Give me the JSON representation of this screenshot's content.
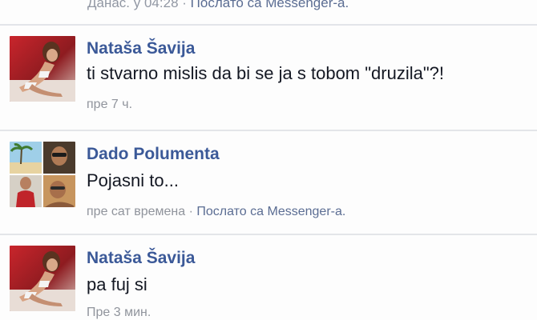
{
  "top_meta": {
    "time": "Данас. у 04:28",
    "separator": " · ",
    "via": "Послато са Messenger-а."
  },
  "messages": [
    {
      "sender": "Nataša Šavija",
      "text": "ti stvarno mislis da bi se ja s tobom \"druzila\"?!",
      "time": "пре 7 ч.",
      "via": ""
    },
    {
      "sender": "Dado Polumenta",
      "text": "Pojasni to...",
      "time": "пре сат времена",
      "separator": " · ",
      "via": "Послато са Messenger-а."
    },
    {
      "sender": "Nataša Šavija",
      "text": "pa fuj si",
      "time": "Пре 3 мин.",
      "via": ""
    }
  ],
  "icons": {
    "avatar_natasa": "profile-photo",
    "avatar_dado": "profile-photo-collage"
  }
}
